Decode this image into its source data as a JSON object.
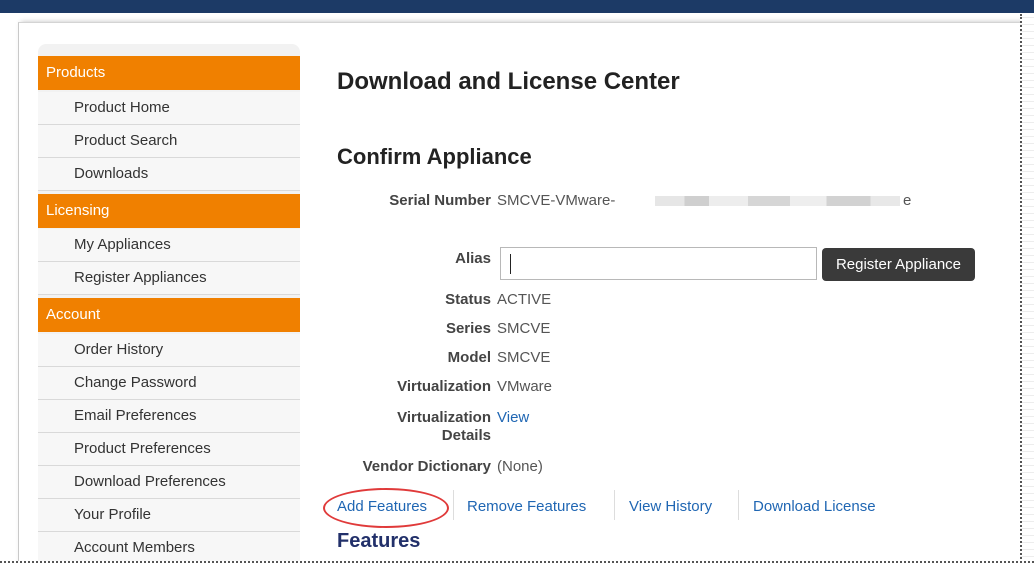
{
  "sidebar": {
    "sections": [
      {
        "label": "Products",
        "items": [
          "Product Home",
          "Product Search",
          "Downloads"
        ]
      },
      {
        "label": "Licensing",
        "items": [
          "My Appliances",
          "Register Appliances"
        ]
      },
      {
        "label": "Account",
        "items": [
          "Order History",
          "Change Password",
          "Email Preferences",
          "Product Preferences",
          "Download Preferences",
          "Your Profile",
          "Account Members"
        ]
      }
    ]
  },
  "main": {
    "title": "Download and License Center",
    "subtitle": "Confirm Appliance",
    "fields": {
      "serial_label": "Serial Number",
      "serial_value": "SMCVE-VMware-",
      "serial_tail": "e",
      "alias_label": "Alias",
      "alias_value": "",
      "register_button": "Register Appliance",
      "status_label": "Status",
      "status_value": "ACTIVE",
      "series_label": "Series",
      "series_value": "SMCVE",
      "model_label": "Model",
      "model_value": "SMCVE",
      "virt_label": "Virtualization",
      "virt_value": "VMware",
      "virt_details_label_1": "Virtualization",
      "virt_details_label_2": "Details",
      "virt_details_link": "View",
      "vendor_label": "Vendor Dictionary",
      "vendor_value": "(None)"
    },
    "actions": [
      "Add Features",
      "Remove Features",
      "View History",
      "Download License"
    ],
    "features_heading": "Features"
  },
  "colors": {
    "accent": "#f08000",
    "link": "#1f66b3",
    "topbar": "#1c3a66",
    "highlight_circle": "#e03a3a"
  }
}
